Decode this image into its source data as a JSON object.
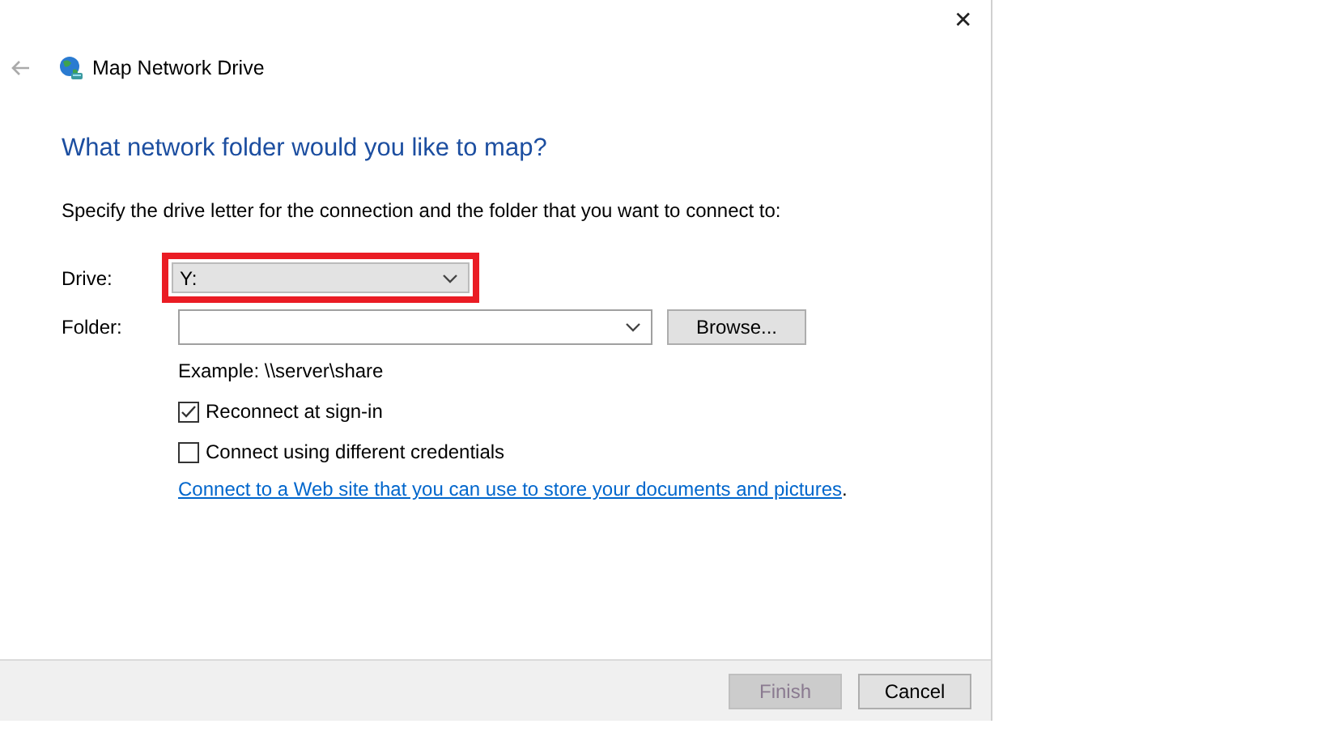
{
  "window": {
    "title": "Map Network Drive",
    "close": "✕"
  },
  "heading": "What network folder would you like to map?",
  "instruction": "Specify the drive letter for the connection and the folder that you want to connect to:",
  "drive": {
    "label": "Drive:",
    "value": "Y:",
    "highlighted": true
  },
  "folder": {
    "label": "Folder:",
    "browse": "Browse..."
  },
  "example": "Example: \\\\server\\share",
  "options": [
    {
      "label": "Reconnect at sign-in",
      "checked": true
    },
    {
      "label": "Connect using different credentials",
      "checked": false
    }
  ],
  "link": {
    "text": "Connect to a Web site that you can use to store your documents and pictures",
    "after": "."
  },
  "buttons": [
    {
      "label": "Finish",
      "disabled": true
    },
    {
      "label": "Cancel",
      "disabled": false
    }
  ]
}
